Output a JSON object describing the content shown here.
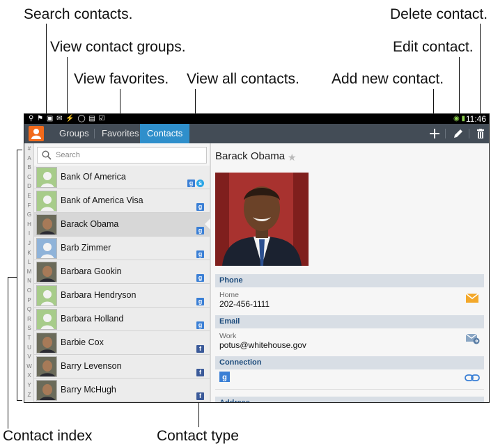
{
  "callouts": {
    "search_contacts": "Search contacts.",
    "view_groups": "View contact groups.",
    "view_favorites": "View favorites.",
    "view_all": "View all contacts.",
    "add_new": "Add new contact.",
    "edit": "Edit contact.",
    "delete": "Delete contact.",
    "contact_index": "Contact index",
    "contact_type": "Contact type"
  },
  "status_bar": {
    "clock": "11:46"
  },
  "tabs": {
    "groups": "Groups",
    "favorites": "Favorites",
    "contacts": "Contacts"
  },
  "toolbar": {
    "add_icon": "plus-icon",
    "edit_icon": "pencil-icon",
    "delete_icon": "trash-icon"
  },
  "index_letters": [
    "#",
    "A",
    "B",
    "C",
    "D",
    "E",
    "F",
    "G",
    "H",
    "I",
    "J",
    "K",
    "L",
    "M",
    "N",
    "O",
    "P",
    "Q",
    "R",
    "S",
    "T",
    "U",
    "V",
    "W",
    "X",
    "Y",
    "Z"
  ],
  "search": {
    "placeholder": "Search"
  },
  "contacts": [
    {
      "name": "Bank Of America",
      "types": [
        "google",
        "skype"
      ],
      "avatar": "default"
    },
    {
      "name": "Bank of America Visa",
      "types": [
        "google"
      ],
      "avatar": "default"
    },
    {
      "name": "Barack Obama",
      "types": [
        "google"
      ],
      "avatar": "photo",
      "selected": true
    },
    {
      "name": "Barb Zimmer",
      "types": [
        "google"
      ],
      "avatar": "default-blue"
    },
    {
      "name": "Barbara Gookin",
      "types": [
        "google"
      ],
      "avatar": "photo"
    },
    {
      "name": "Barbara Hendryson",
      "types": [
        "google"
      ],
      "avatar": "default"
    },
    {
      "name": "Barbara Holland",
      "types": [
        "google"
      ],
      "avatar": "default"
    },
    {
      "name": "Barbie Cox",
      "types": [
        "facebook"
      ],
      "avatar": "photo"
    },
    {
      "name": "Barry Levenson",
      "types": [
        "facebook"
      ],
      "avatar": "photo"
    },
    {
      "name": "Barry McHugh",
      "types": [
        "facebook"
      ],
      "avatar": "photo"
    }
  ],
  "detail": {
    "name": "Barack Obama",
    "sections": {
      "phone": "Phone",
      "email": "Email",
      "connection": "Connection",
      "address": "Address"
    },
    "phone": {
      "label": "Home",
      "value": "202-456-1111"
    },
    "email": {
      "label": "Work",
      "value": "potus@whitehouse.gov"
    }
  },
  "colors": {
    "accent": "#2f8fcb",
    "actionbar": "#434c56",
    "app_icon": "#f26a1b",
    "section_text": "#1f4d7d"
  }
}
